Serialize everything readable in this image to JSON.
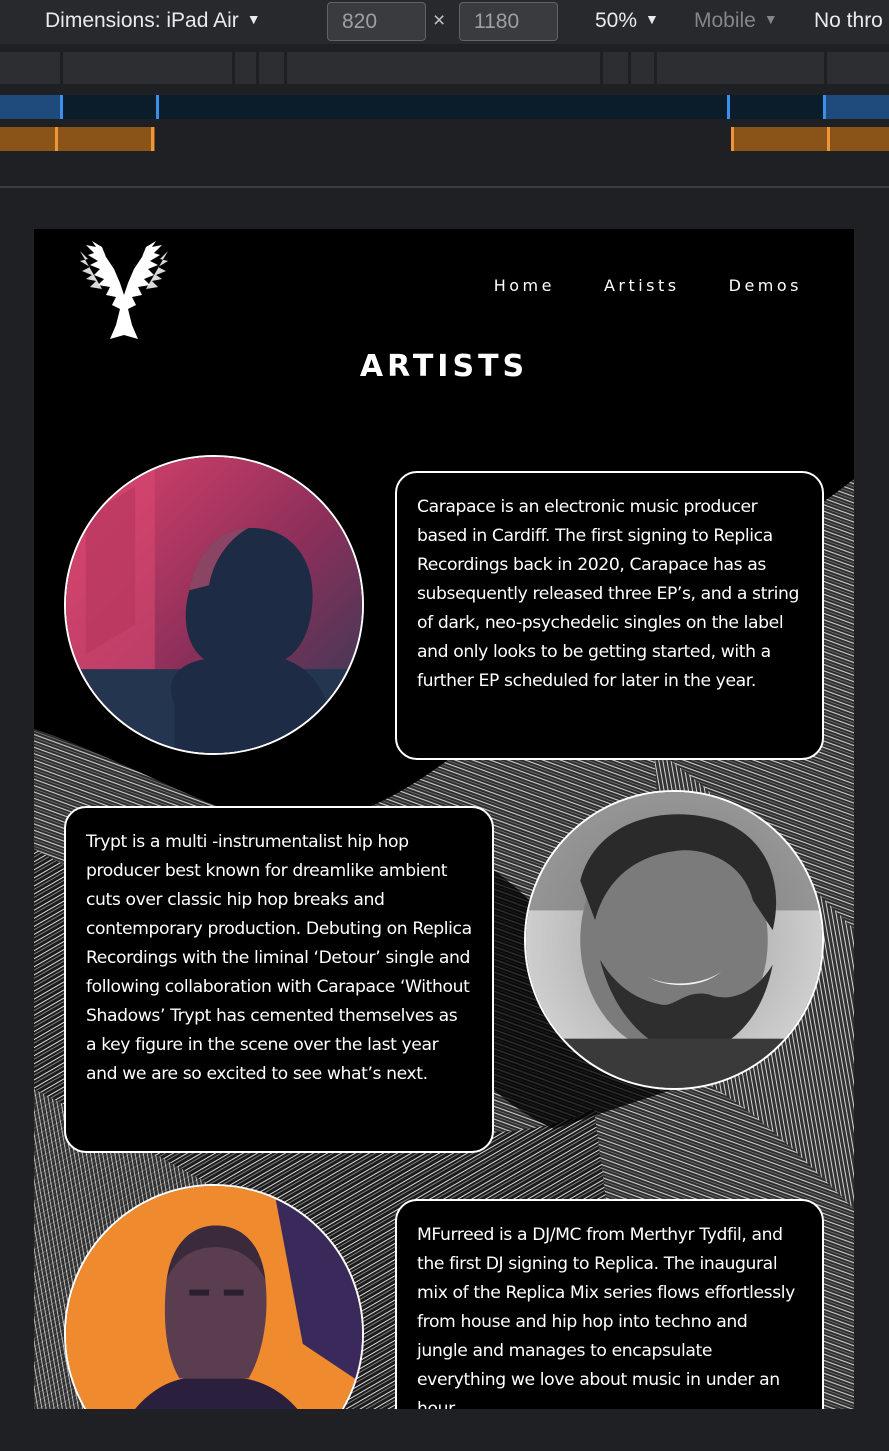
{
  "devtools": {
    "dimensions_label": "Dimensions: iPad Air",
    "width": "820",
    "height": "1180",
    "times": "×",
    "zoom": "50%",
    "device_mode": "Mobile",
    "throttle": "No thro",
    "caret": "▼"
  },
  "site": {
    "nav": [
      "Home",
      "Artists",
      "Demos"
    ],
    "title": "ARTISTS",
    "artists": [
      {
        "bio": "Carapace is an electronic music producer based in Cardiff. The first signing to Replica Recordings back in 2020, Carapace has as subsequently released three EP’s, and a string of dark, neo-psychedelic singles on the label and only looks to be getting started, with a further EP scheduled for later in the year."
      },
      {
        "bio": "Trypt is a multi -instrumentalist hip hop producer best known for dreamlike ambient cuts over classic hip hop breaks and contemporary production. Debuting on Replica Recordings with the liminal ‘Detour’ single and following collaboration with Carapace ‘Without Shadows’ Trypt has cemented themselves as a key figure in the scene over the last year and we are so excited to see what’s next."
      },
      {
        "bio": "MFurreed is a DJ/MC from Merthyr Tydfil, and the first DJ signing to Replica. The inaugural mix of the Replica Mix series flows effortlessly from house and hip hop into techno and jungle and manages to encapsulate everything we love about music in under an hour."
      }
    ]
  },
  "colors": {
    "toolbar": "#28292c",
    "mq_blue": "#1e4b7c",
    "mq_orange": "#8a5419",
    "photo1_tint": "#c8395e",
    "photo3_tint": "#f08a2e"
  }
}
